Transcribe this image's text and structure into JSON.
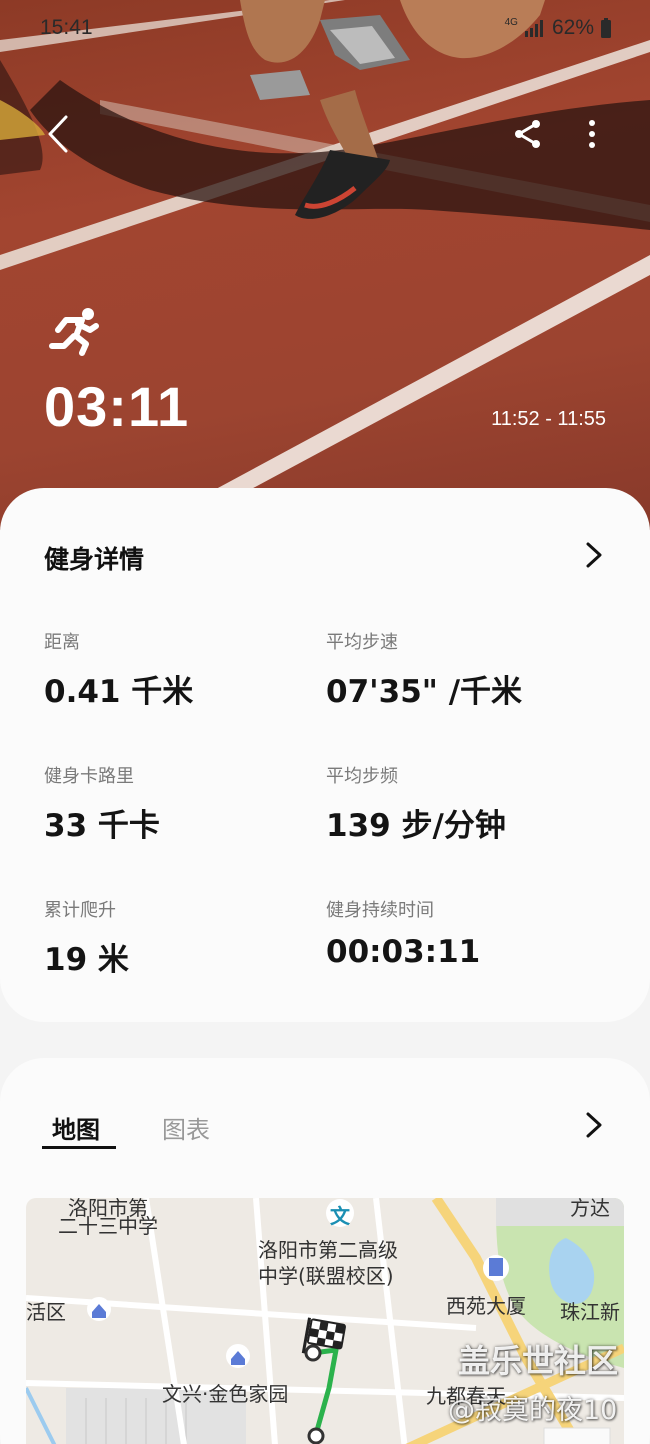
{
  "status_bar": {
    "time": "15:41",
    "network": "4G",
    "battery": "62%"
  },
  "header": {
    "duration": "03:11",
    "time_range": "11:52 - 11:55"
  },
  "details": {
    "title": "健身详情",
    "stats": [
      {
        "label": "距离",
        "value": "0.41 千米"
      },
      {
        "label": "平均步速",
        "value": "07'35\" /千米"
      },
      {
        "label": "健身卡路里",
        "value": "33 千卡"
      },
      {
        "label": "平均步频",
        "value": "139 步/分钟"
      },
      {
        "label": "累计爬升",
        "value": "19 米"
      },
      {
        "label": "健身持续时间",
        "value": "00:03:11"
      }
    ]
  },
  "map_section": {
    "tabs": [
      "地图",
      "图表"
    ],
    "labels": [
      "洛阳市第",
      "二十三中学",
      "洛阳市第二高级",
      "中学(联盟校区)",
      "活区",
      "西苑大厦",
      "珠江新",
      "方达",
      "文兴·金色家园",
      "九都春天",
      "文"
    ]
  },
  "watermark": {
    "line1": "盖乐世社区",
    "line2": "@寂寞的夜10"
  },
  "colors": {
    "track": "#9c4430",
    "route": "#2bb24c",
    "accent": "#111111"
  }
}
